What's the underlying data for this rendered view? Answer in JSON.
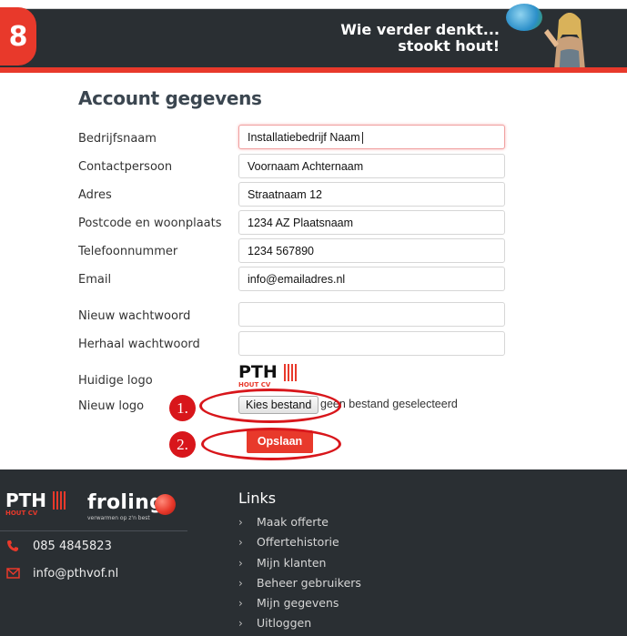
{
  "header": {
    "step_number": "8",
    "slogan_line1": "Wie verder denkt...",
    "slogan_line2": "stookt hout!"
  },
  "form": {
    "title": "Account gegevens",
    "fields": [
      {
        "label": "Bedrijfsnaam",
        "value": "Installatiebedrijf Naam"
      },
      {
        "label": "Contactpersoon",
        "value": "Voornaam Achternaam"
      },
      {
        "label": "Adres",
        "value": "Straatnaam 12"
      },
      {
        "label": "Postcode en woonplaats",
        "value": "1234 AZ Plaatsnaam"
      },
      {
        "label": "Telefoonnummer",
        "value": "1234 567890"
      },
      {
        "label": "Email",
        "value": "info@emailadres.nl"
      },
      {
        "label": "Nieuw wachtwoord",
        "value": ""
      },
      {
        "label": "Herhaal wachtwoord",
        "value": ""
      }
    ],
    "current_logo_label": "Huidige logo",
    "new_logo_label": "Nieuw logo",
    "file_button_label": "Kies bestand",
    "file_status": "geen bestand geselecteerd",
    "save_label": "Opslaan"
  },
  "annotations": {
    "one": "1.",
    "two": "2."
  },
  "logo": {
    "pth": "PTH",
    "subtitle": "HOUT CV"
  },
  "footer": {
    "brand2": "froling",
    "brand2_tagline": "verwarmen op z'n best",
    "phone": "085 4845823",
    "email": "info@pthvof.nl",
    "links_title": "Links",
    "links": [
      "Maak offerte",
      "Offertehistorie",
      "Mijn klanten",
      "Beheer gebruikers",
      "Mijn gegevens",
      "Uitloggen"
    ]
  },
  "colors": {
    "accent": "#e8392b",
    "dark": "#2a2f33",
    "annotation": "#d8161b"
  }
}
